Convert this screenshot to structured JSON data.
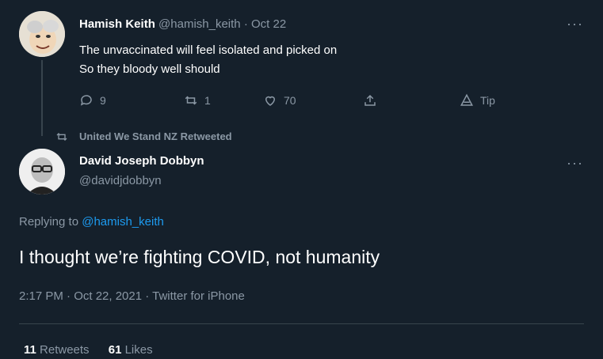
{
  "parent_tweet": {
    "name": "Hamish Keith",
    "handle": "@hamish_keith",
    "dot": "·",
    "date": "Oct 22",
    "line1": "The unvaccinated will feel isolated and picked on",
    "line2": "So they bloody well should",
    "more": "···",
    "actions": {
      "replies": "9",
      "retweets": "1",
      "likes": "70",
      "tip": "Tip"
    }
  },
  "retweet_banner": {
    "text": "United We Stand NZ Retweeted"
  },
  "main_tweet": {
    "name": "David Joseph Dobbyn",
    "handle": "@davidjdobbyn",
    "more": "···",
    "replying_prefix": "Replying to ",
    "replying_handle": "@hamish_keith",
    "text": "I thought we’re fighting COVID, not humanity",
    "timestamp": "2:17 PM · Oct 22, 2021 · Twitter for iPhone",
    "stats": {
      "retweets_count": "11",
      "retweets_label": "Retweets",
      "likes_count": "61",
      "likes_label": "Likes"
    }
  },
  "colors": {
    "background": "#15202b",
    "text": "#ffffff",
    "muted": "#8b98a5",
    "accent": "#1d9bf0",
    "border": "#38444d"
  }
}
